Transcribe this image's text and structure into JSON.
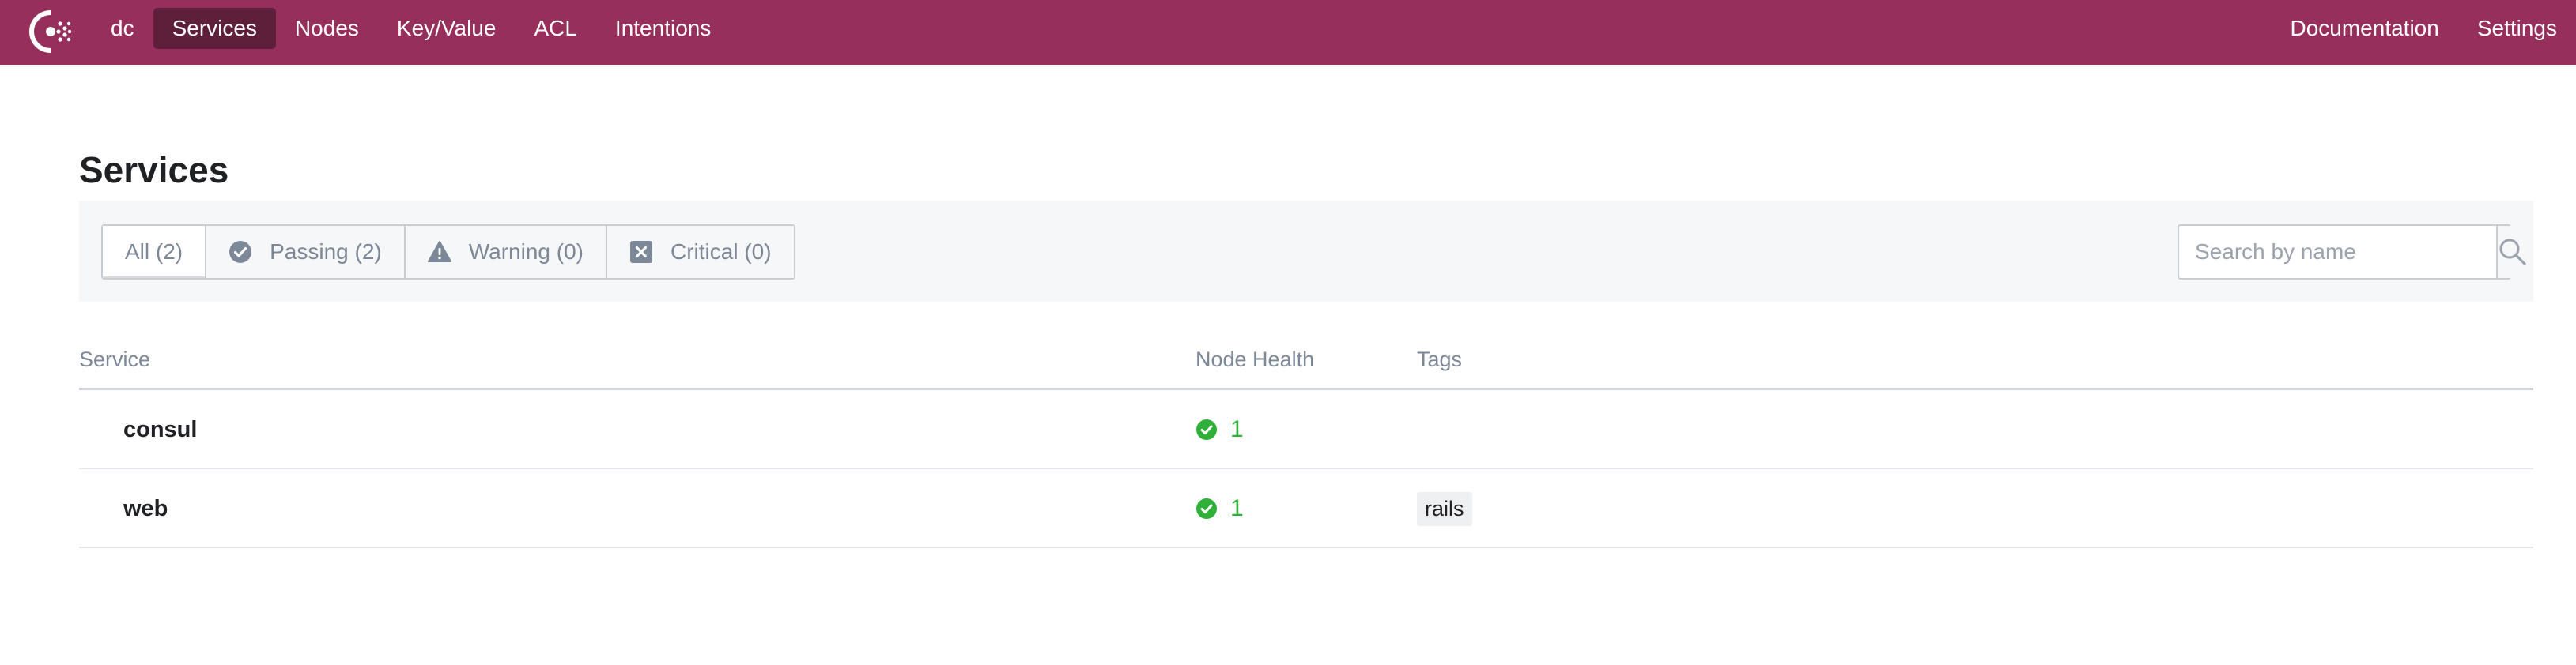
{
  "nav": {
    "logo_icon": "consul-logo-icon",
    "datacenter": "dc",
    "items": [
      {
        "label": "Services",
        "active": true
      },
      {
        "label": "Nodes",
        "active": false
      },
      {
        "label": "Key/Value",
        "active": false
      },
      {
        "label": "ACL",
        "active": false
      },
      {
        "label": "Intentions",
        "active": false
      }
    ],
    "right": [
      {
        "label": "Documentation"
      },
      {
        "label": "Settings"
      }
    ],
    "colors": {
      "bar": "#962f5c",
      "active": "#5e1f3b"
    }
  },
  "page": {
    "title": "Services"
  },
  "filters": {
    "all": "All (2)",
    "passing": "Passing (2)",
    "warning": "Warning (0)",
    "critical": "Critical (0)",
    "icons": [
      "check-circle-icon",
      "warning-triangle-icon",
      "critical-x-icon"
    ]
  },
  "search": {
    "placeholder": "Search by name",
    "value": "",
    "icon": "search-icon"
  },
  "table": {
    "headers": {
      "service": "Service",
      "health": "Node Health",
      "tags": "Tags"
    },
    "rows": [
      {
        "name": "consul",
        "health": "1",
        "tags": []
      },
      {
        "name": "web",
        "health": "1",
        "tags": [
          "rails"
        ]
      }
    ],
    "colors": {
      "passing": "#2eb039"
    }
  }
}
